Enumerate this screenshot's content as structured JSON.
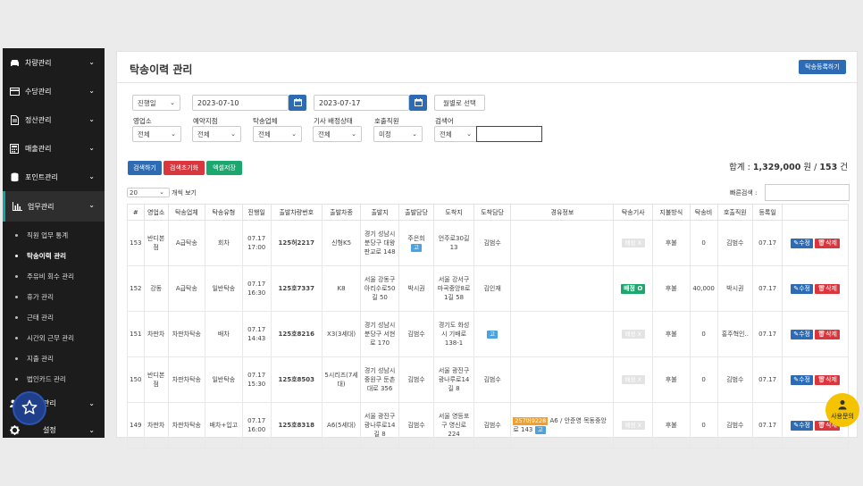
{
  "sidebar": {
    "items": [
      {
        "label": "차량관리",
        "icon": "car-icon"
      },
      {
        "label": "수당관리",
        "icon": "card-icon"
      },
      {
        "label": "정산관리",
        "icon": "document-icon"
      },
      {
        "label": "매출관리",
        "icon": "calculator-icon"
      },
      {
        "label": "포인트관리",
        "icon": "database-icon"
      },
      {
        "label": "업무관리",
        "icon": "chart-icon"
      }
    ],
    "sub_items": [
      "직원 업무 통계",
      "탁송이력 관리",
      "주유비 회수 관리",
      "휴가 관리",
      "근태 관리",
      "시간외 근무 관리",
      "지출 관리",
      "법인카드 관리"
    ],
    "bottom_items": [
      {
        "label": "관리",
        "icon": "users-icon"
      },
      {
        "label": "설정",
        "icon": "gear-icon"
      }
    ]
  },
  "page": {
    "title": "탁송이력 관리",
    "register_button": "탁송등록하기"
  },
  "filters": {
    "status_select": "진행일",
    "date_from": "2023-07-10",
    "date_to": "2023-07-17",
    "monthly_button": "월별로 선택",
    "branch_label": "영업소",
    "branch_value": "전체",
    "reserve_label": "예약지점",
    "reserve_value": "전체",
    "company_label": "탁송업체",
    "company_value": "전체",
    "driver_status_label": "기사 배정상태",
    "driver_status_value": "전체",
    "caller_label": "호출직원",
    "caller_value": "미정",
    "search_label": "검색어",
    "search_select": "전체",
    "search_value": ""
  },
  "actions": {
    "search": "검색하기",
    "reset": "검색초기화",
    "excel": "엑셀저장"
  },
  "summary": {
    "prefix": "합계 : ",
    "amount": "1,329,000",
    "unit": " 원 / ",
    "count": "153",
    "count_unit": " 건"
  },
  "table_controls": {
    "page_size": "20",
    "page_size_label": "개씩 보기",
    "quick_search_label": "빠른검색 :"
  },
  "table": {
    "headers": [
      "#",
      "영업소",
      "탁송업체",
      "탁송유형",
      "진행일",
      "출발차량번호",
      "출발차종",
      "출발지",
      "출발담당",
      "도착지",
      "도착담당",
      "경유정보",
      "탁송기사",
      "지불방식",
      "탁송비",
      "호출직원",
      "등록일",
      ""
    ],
    "rows": [
      {
        "no": "153",
        "branch": "반디본점",
        "company": "A급탁송",
        "type": "회차",
        "date": "07.17 17:00",
        "plate": "125허2217",
        "model": "신형K5",
        "from": "경기 성남시 분당구 대왕판교로 148",
        "from_mgr": "주은희",
        "from_tag": "고",
        "to": "언주로30길13",
        "to_mgr": "김범수",
        "to_tag": "",
        "via_tag": "",
        "via": "",
        "driver_state": "배정 X",
        "driver_green": false,
        "pay": "후불",
        "fee": "0",
        "caller": "김범수",
        "reg": "07.17"
      },
      {
        "no": "152",
        "branch": "강동",
        "company": "A급탁송",
        "type": "일반탁송",
        "date": "07.17 16:30",
        "plate": "125호7337",
        "model": "K8",
        "from": "서울 강동구 아리수로50길 50",
        "from_mgr": "박시권",
        "from_tag": "",
        "to": "서울 강서구 마곡중앙8로1길 58",
        "to_mgr": "김인재",
        "to_tag": "",
        "via_tag": "",
        "via": "",
        "driver_state": "배정 O",
        "driver_green": true,
        "pay": "후불",
        "fee": "40,000",
        "caller": "박시권",
        "reg": "07.17"
      },
      {
        "no": "151",
        "branch": "차판차",
        "company": "차판차탁송",
        "type": "배차",
        "date": "07.17 14:43",
        "plate": "125호8216",
        "model": "X3(3세대)",
        "from": "경기 성남시 분당구 서현로 170",
        "from_mgr": "김범수",
        "from_tag": "",
        "to": "경기도 화성시 기배로138-1",
        "to_mgr": "",
        "to_tag": "고",
        "via_tag": "",
        "via": "",
        "driver_state": "배정 X",
        "driver_green": false,
        "pay": "후불",
        "fee": "0",
        "caller": "홍주혁인..",
        "reg": "07.17"
      },
      {
        "no": "150",
        "branch": "반디본점",
        "company": "차판차탁송",
        "type": "일반탁송",
        "date": "07.17 15:30",
        "plate": "125호8503",
        "model": "5시리즈(7세대)",
        "from": "경기 성남시 중원구 둔촌대로 356",
        "from_mgr": "김범수",
        "from_tag": "",
        "to": "서울 광진구 광나루로14길 8",
        "to_mgr": "김범수",
        "to_tag": "",
        "via_tag": "",
        "via": "",
        "driver_state": "배정 X",
        "driver_green": false,
        "pay": "후불",
        "fee": "0",
        "caller": "김범수",
        "reg": "07.17"
      },
      {
        "no": "149",
        "branch": "차판차",
        "company": "차판차탁송",
        "type": "배차+입고",
        "date": "07.17 16:00",
        "plate": "125호8318",
        "model": "A6(5세대)",
        "from": "서울 광진구 광나루로14길 8",
        "from_mgr": "김범수",
        "from_tag": "",
        "to": "서울 영등포구 영신로 224",
        "to_mgr": "김범수",
        "to_tag": "",
        "via_tag": "257버9228",
        "via": "A6 / 안준영 목동중앙로 143",
        "driver_state": "배정 X",
        "driver_green": false,
        "pay": "후불",
        "fee": "0",
        "caller": "김범수",
        "reg": "07.17"
      }
    ],
    "edit_label": "수정",
    "delete_label": "삭제",
    "via_tag_extra": "고"
  },
  "help": {
    "label": "사용문의"
  },
  "colors": {
    "primary": "#2d6cb5",
    "danger": "#d9363e",
    "success": "#1aa86e",
    "sidebar": "#1c1c1c"
  }
}
